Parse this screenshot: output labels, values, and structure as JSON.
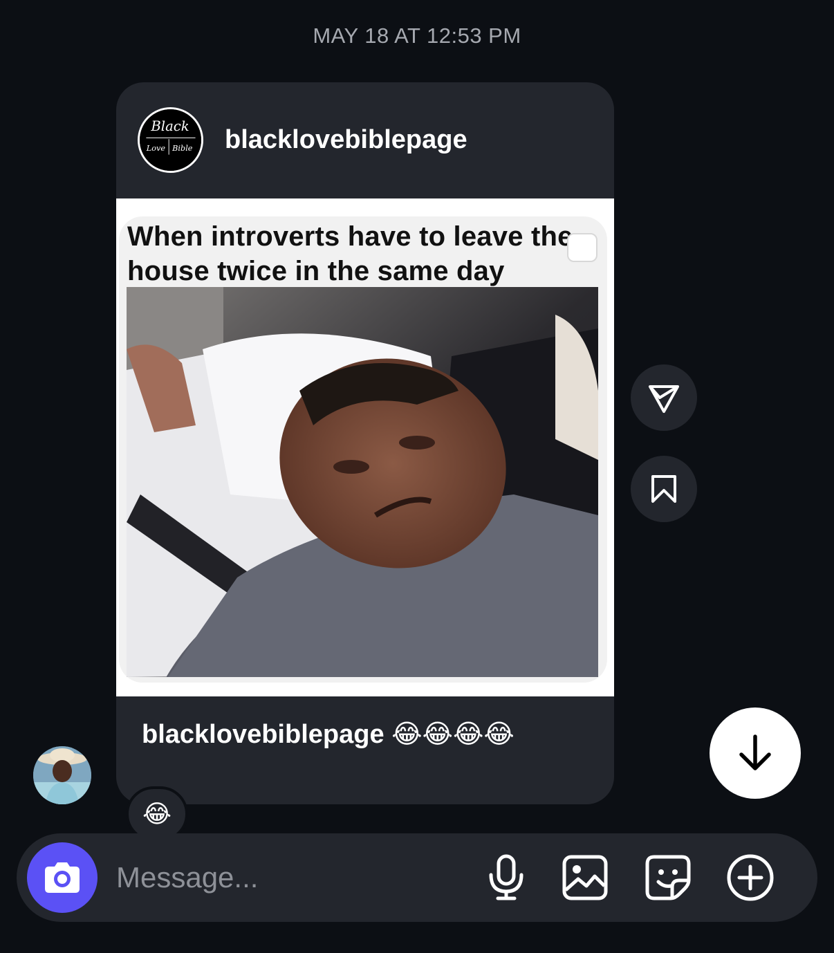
{
  "conversation": {
    "timestamp": "MAY 18 AT 12:53 PM"
  },
  "shared_post": {
    "username": "blacklovebiblepage",
    "avatar_logo_text": [
      "Black",
      "Love",
      "Bible"
    ],
    "meme_caption": "When introverts have to leave the house twice in the same day",
    "caption_username": "blacklovebiblepage",
    "caption_emojis": "😂😂😂😂"
  },
  "reaction": {
    "emoji": "😂"
  },
  "side_actions": {
    "share_icon": "paper-plane-icon",
    "save_icon": "bookmark-icon"
  },
  "scroll_down": {
    "icon": "arrow-down-icon"
  },
  "composer": {
    "placeholder": "Message...",
    "camera_icon": "camera-icon",
    "mic_icon": "microphone-icon",
    "gallery_icon": "image-icon",
    "sticker_icon": "sticker-icon",
    "plus_icon": "plus-circle-icon",
    "accent_color": "#5b51f5"
  },
  "colors": {
    "background": "#0c0f14",
    "bubble": "#23262d",
    "muted_text": "#a6a9b0"
  }
}
